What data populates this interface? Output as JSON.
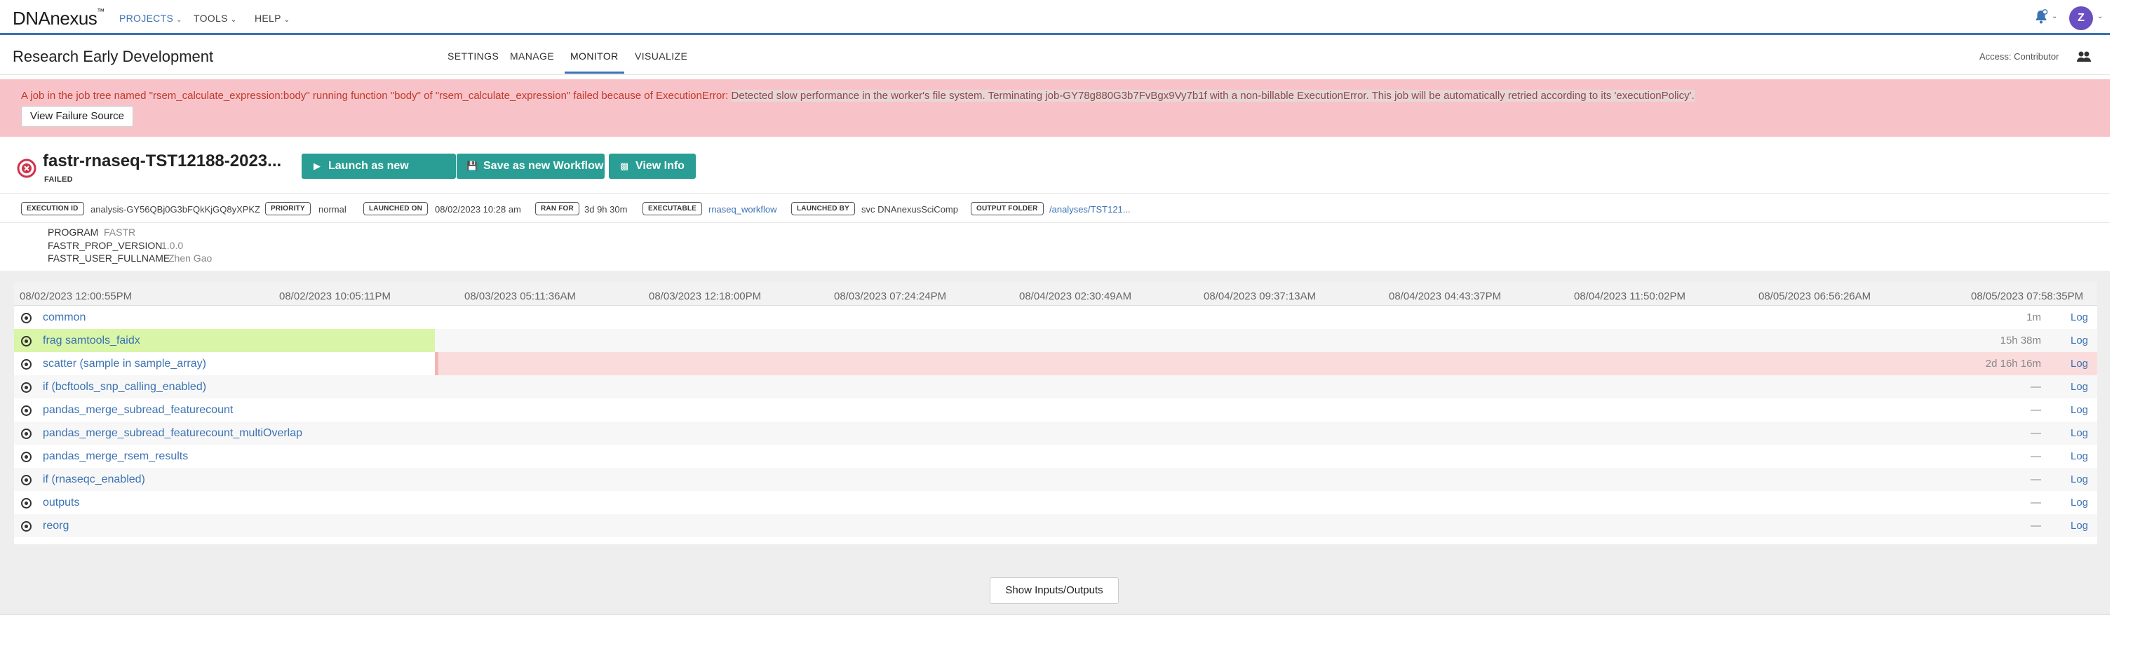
{
  "nav": {
    "logo": "DNAnexus",
    "logo_tm": "™",
    "projects": "PROJECTS",
    "tools": "TOOLS",
    "help": "HELP",
    "avatar_initial": "Z"
  },
  "project": {
    "title": "Research Early Development",
    "tabs": [
      "SETTINGS",
      "MANAGE",
      "MONITOR",
      "VISUALIZE"
    ],
    "active_tab": "MONITOR",
    "access": "Access: Contributor"
  },
  "alert": {
    "text_part1": "A job in the job tree named \"rsem_calculate_expression:body\" running function \"body\" of \"rsem_calculate_expression\" failed because of ExecutionError: ",
    "text_part2": "Detected slow performance in the worker's file system. Terminating job-GY78g880G3b7FvBgx9Vy7b1f with a non-billable ExecutionError. This job will be automatically retried according to its 'executionPolicy'.",
    "button": "View Failure Source"
  },
  "analysis": {
    "title": "fastr-rnaseq-TST12188-2023...",
    "status": "FAILED",
    "buttons": {
      "launch": "Launch as new Analysis",
      "save": "Save as new Workflow",
      "info": "View Info"
    }
  },
  "meta": {
    "execution_id_label": "EXECUTION ID",
    "execution_id": "analysis-GY56QBj0G3bFQkKjGQ8yXPKZ",
    "priority_label": "PRIORITY",
    "priority": "normal",
    "launched_on_label": "LAUNCHED ON",
    "launched_on": "08/02/2023 10:28 am",
    "ran_for_label": "RAN FOR",
    "ran_for": "3d 9h 30m",
    "executable_label": "EXECUTABLE",
    "executable": "rnaseq_workflow",
    "launched_by_label": "LAUNCHED BY",
    "launched_by": "svc DNAnexusSciComp",
    "output_folder_label": "OUTPUT FOLDER",
    "output_folder": "/analyses/TST121..."
  },
  "properties": [
    {
      "key": "PROGRAM",
      "value": "FASTR"
    },
    {
      "key": "FASTR_PROP_VERSION",
      "value": "1.0.0"
    },
    {
      "key": "FASTR_USER_FULLNAME",
      "value": "Zhen Gao"
    }
  ],
  "timeline": {
    "ticks": [
      "08/02/2023 12:00:55PM",
      "08/02/2023 10:05:11PM",
      "08/03/2023 05:11:36AM",
      "08/03/2023 12:18:00PM",
      "08/03/2023 07:24:24PM",
      "08/04/2023 02:30:49AM",
      "08/04/2023 09:37:13AM",
      "08/04/2023 04:43:37PM",
      "08/04/2023 11:50:02PM",
      "08/05/2023 06:56:26AM",
      "08/05/2023 07:58:35PM"
    ],
    "rows": [
      {
        "name": "common",
        "duration": "1m",
        "log": "Log",
        "state": "done",
        "start_frac": 0,
        "end_frac": 0
      },
      {
        "name": "frag samtools_faidx",
        "duration": "15h 38m",
        "log": "Log",
        "state": "done",
        "start_frac": 0,
        "end_frac": 0.202
      },
      {
        "name": "scatter (sample in sample_array)",
        "duration": "2d 16h 16m",
        "log": "Log",
        "state": "failed",
        "start_frac": 0.202,
        "end_frac": 1.0
      },
      {
        "name": "if (bcftools_snp_calling_enabled)",
        "duration": "—",
        "log": "Log",
        "state": "none"
      },
      {
        "name": "pandas_merge_subread_featurecount",
        "duration": "—",
        "log": "Log",
        "state": "none"
      },
      {
        "name": "pandas_merge_subread_featurecount_multiOverlap",
        "duration": "—",
        "log": "Log",
        "state": "none"
      },
      {
        "name": "pandas_merge_rsem_results",
        "duration": "—",
        "log": "Log",
        "state": "none"
      },
      {
        "name": "if (rnaseqc_enabled)",
        "duration": "—",
        "log": "Log",
        "state": "none"
      },
      {
        "name": "outputs",
        "duration": "—",
        "log": "Log",
        "state": "none"
      },
      {
        "name": "reorg",
        "duration": "—",
        "log": "Log",
        "state": "none"
      }
    ]
  },
  "io_button": "Show Inputs/Outputs",
  "colors": {
    "accent": "#3c73b3",
    "teal": "#2a9d94",
    "alert_bg": "#f8c3c8",
    "alert_text": "#c0392b",
    "done_bar": "#d9f5a8",
    "failed_bar": "#fbdcdc",
    "failed_icon": "#d0324a",
    "avatar": "#6a4fc2"
  }
}
